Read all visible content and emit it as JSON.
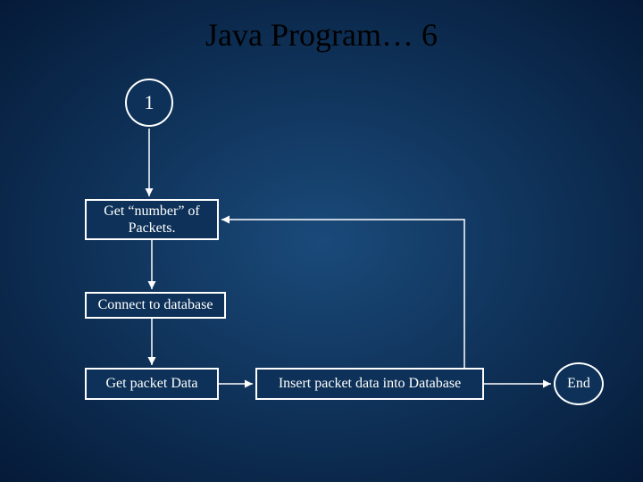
{
  "title": "Java Program… 6",
  "connector": "1",
  "step1": "Get “number” of Packets.",
  "step2": "Connect to database",
  "step3": "Get packet Data",
  "step4": "Insert packet data into Database",
  "end": "End",
  "chart_data": {
    "type": "flowchart",
    "nodes": [
      {
        "id": "n1",
        "shape": "circle",
        "label": "1",
        "role": "connector"
      },
      {
        "id": "n2",
        "shape": "rect",
        "label": "Get “number” of Packets."
      },
      {
        "id": "n3",
        "shape": "rect",
        "label": "Connect to database"
      },
      {
        "id": "n4",
        "shape": "rect",
        "label": "Get packet Data"
      },
      {
        "id": "n5",
        "shape": "rect",
        "label": "Insert packet data into Database"
      },
      {
        "id": "n6",
        "shape": "circle",
        "label": "End",
        "role": "terminator"
      }
    ],
    "edges": [
      {
        "from": "n1",
        "to": "n2"
      },
      {
        "from": "n2",
        "to": "n3"
      },
      {
        "from": "n3",
        "to": "n4"
      },
      {
        "from": "n4",
        "to": "n5"
      },
      {
        "from": "n5",
        "to": "n6"
      },
      {
        "from": "n5",
        "to": "n2",
        "kind": "loop-back"
      }
    ]
  }
}
